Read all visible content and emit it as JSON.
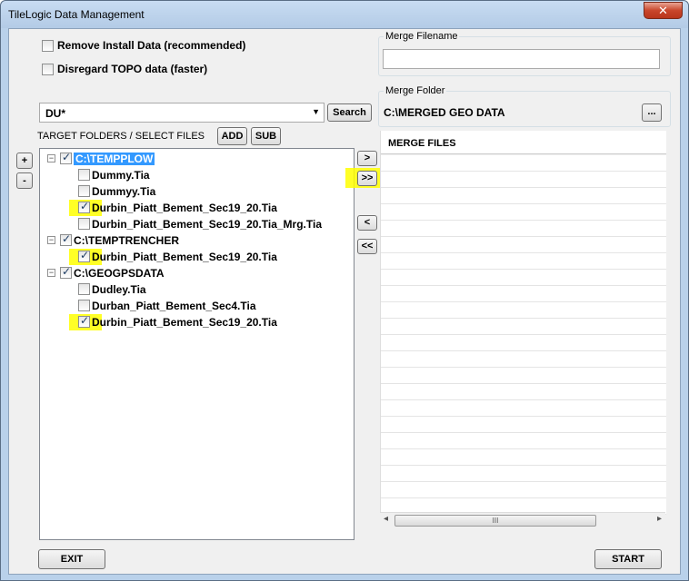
{
  "window": {
    "title": "TileLogic Data Management",
    "close_label": "✕"
  },
  "options": {
    "remove_install": "Remove Install Data (recommended)",
    "disregard_topo": "Disregard TOPO data (faster)"
  },
  "search": {
    "value": "DU*",
    "button": "Search"
  },
  "target": {
    "label": "TARGET FOLDERS / SELECT FILES",
    "add": "ADD",
    "sub": "SUB"
  },
  "side_buttons": {
    "plus": "+",
    "minus": "-"
  },
  "tree": [
    {
      "label": "C:\\TEMPPLOW",
      "level": 0,
      "checked": true,
      "selected": true
    },
    {
      "label": "Dummy.Tia",
      "level": 1,
      "checked": false
    },
    {
      "label": "Dummyy.Tia",
      "level": 1,
      "checked": false
    },
    {
      "label": "Durbin_Piatt_Bement_Sec19_20.Tia",
      "level": 1,
      "checked": true,
      "highlight": true
    },
    {
      "label": "Durbin_Piatt_Bement_Sec19_20.Tia_Mrg.Tia",
      "level": 1,
      "checked": false
    },
    {
      "label": "C:\\TEMPTRENCHER",
      "level": 0,
      "checked": true
    },
    {
      "label": "Durbin_Piatt_Bement_Sec19_20.Tia",
      "level": 1,
      "checked": true,
      "highlight": true
    },
    {
      "label": "C:\\GEOGPSDATA",
      "level": 0,
      "checked": true
    },
    {
      "label": "Dudley.Tia",
      "level": 1,
      "checked": false
    },
    {
      "label": "Durban_Piatt_Bement_Sec4.Tia",
      "level": 1,
      "checked": false
    },
    {
      "label": "Durbin_Piatt_Bement_Sec19_20.Tia",
      "level": 1,
      "checked": true,
      "highlight": true
    }
  ],
  "transfer": {
    "move_one": ">",
    "move_all": ">>",
    "remove_one": "<",
    "remove_all": "<<"
  },
  "merge_filename": {
    "label": "Merge Filename",
    "value": ""
  },
  "merge_folder": {
    "label": "Merge Folder",
    "value": "C:\\MERGED GEO DATA",
    "browse": "..."
  },
  "merge_files": {
    "header": "MERGE FILES",
    "rows": []
  },
  "scrollbar": {
    "left": "◂",
    "right": "▸",
    "grip": "III"
  },
  "footer": {
    "exit": "EXIT",
    "start": "START"
  },
  "colors": {
    "highlight": "#ffff00",
    "selection": "#3399ff"
  }
}
